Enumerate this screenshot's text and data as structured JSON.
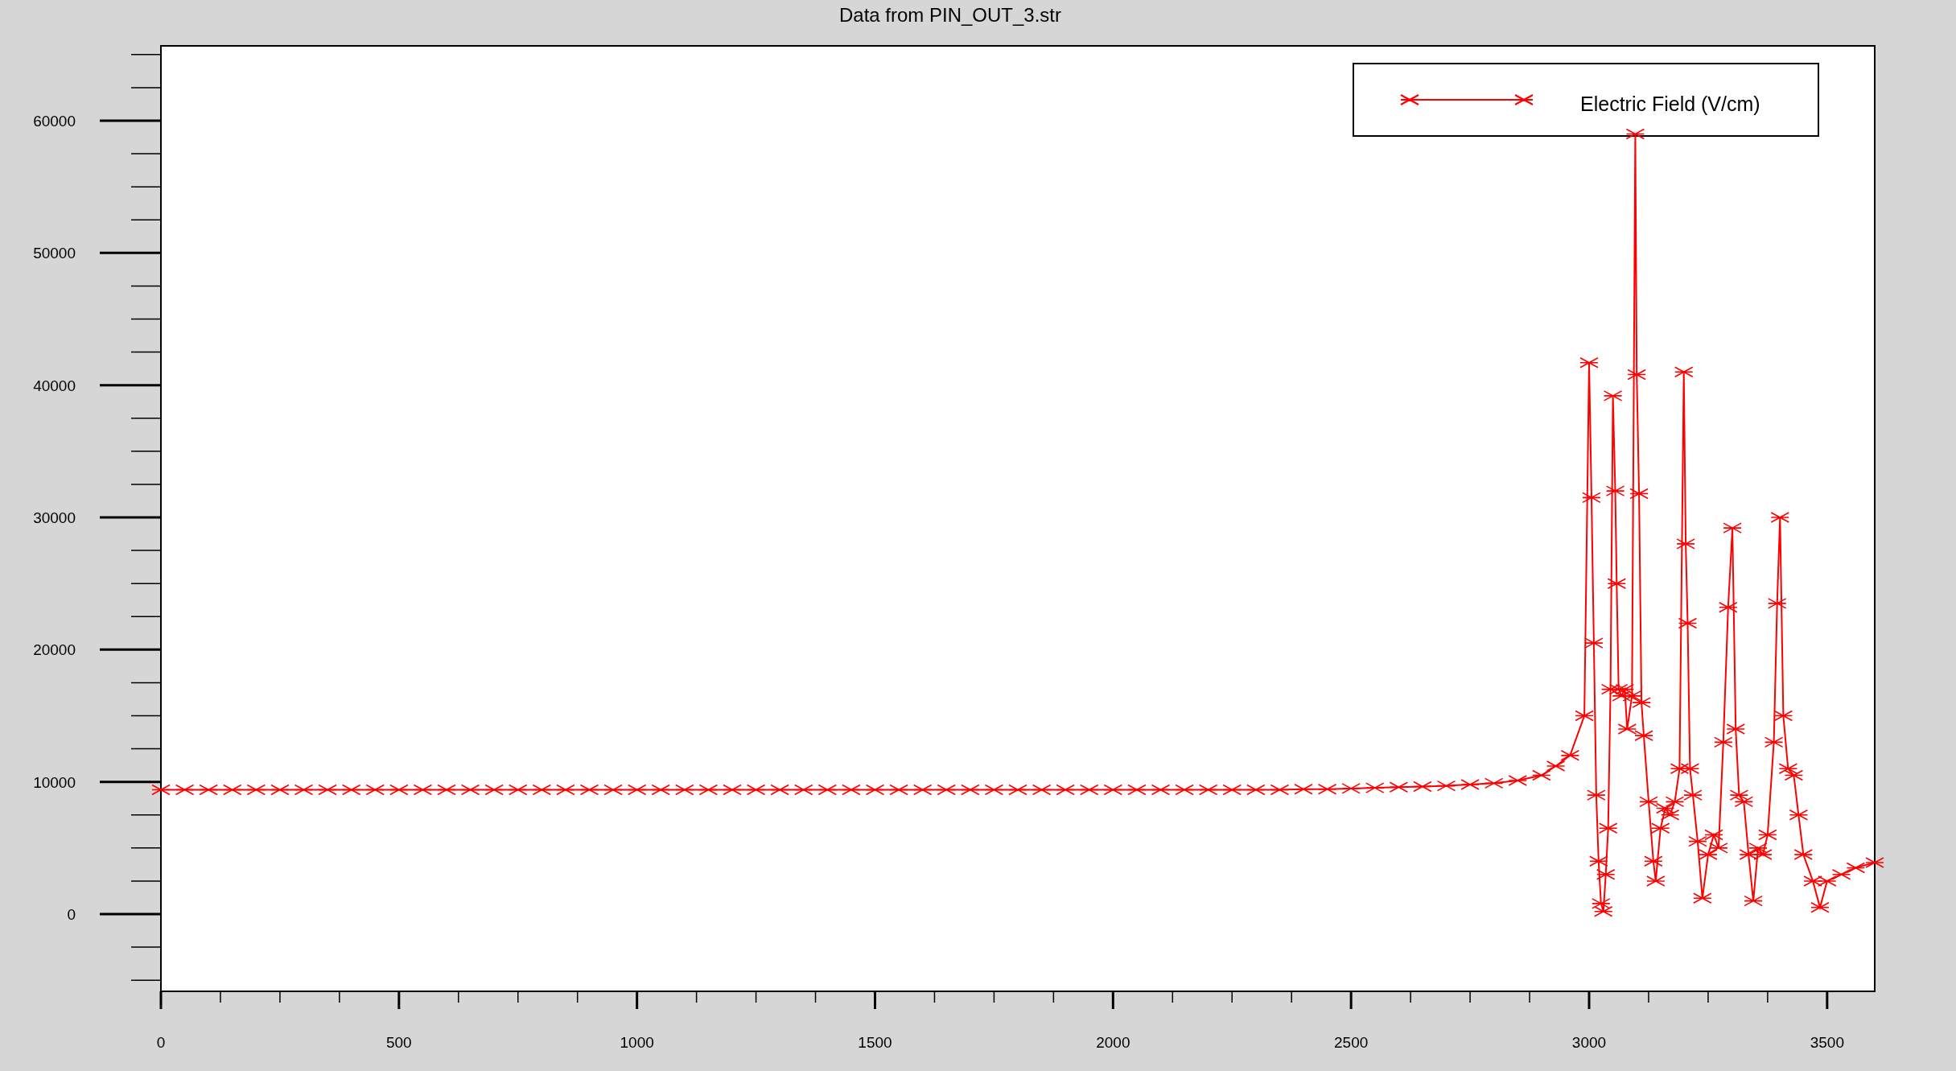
{
  "chart_data": {
    "type": "line",
    "title": "Data from PIN_OUT_3.str",
    "xlim": [
      0,
      3600
    ],
    "ylim": [
      -5840,
      65660
    ],
    "xticks": [
      0,
      500,
      1000,
      1500,
      2000,
      2500,
      3000,
      3500
    ],
    "yticks": [
      0,
      10000,
      20000,
      30000,
      40000,
      50000,
      60000
    ],
    "x": [
      0,
      50,
      100,
      150,
      200,
      250,
      300,
      350,
      400,
      450,
      500,
      550,
      600,
      650,
      700,
      750,
      800,
      850,
      900,
      950,
      1000,
      1050,
      1100,
      1150,
      1200,
      1250,
      1300,
      1350,
      1400,
      1450,
      1500,
      1550,
      1600,
      1650,
      1700,
      1750,
      1800,
      1850,
      1900,
      1950,
      2000,
      2050,
      2100,
      2150,
      2200,
      2250,
      2300,
      2350,
      2400,
      2450,
      2500,
      2550,
      2600,
      2650,
      2700,
      2750,
      2800,
      2850,
      2900,
      2930,
      2960,
      2990,
      3000,
      3005,
      3010,
      3015,
      3020,
      3025,
      3030,
      3035,
      3040,
      3045,
      3050,
      3055,
      3058,
      3062,
      3068,
      3075,
      3080,
      3090,
      3097,
      3100,
      3105,
      3110,
      3115,
      3125,
      3135,
      3140,
      3150,
      3160,
      3170,
      3180,
      3190,
      3199,
      3203,
      3207,
      3212,
      3218,
      3228,
      3238,
      3250,
      3262,
      3272,
      3282,
      3292,
      3301,
      3308,
      3315,
      3325,
      3335,
      3345,
      3355,
      3365,
      3375,
      3388,
      3395,
      3401,
      3408,
      3418,
      3430,
      3440,
      3450,
      3470,
      3485,
      3500,
      3530,
      3560,
      3600
    ],
    "series": [
      {
        "name": "Electric Field (V/cm)",
        "color": "#ff0000",
        "marker": "x",
        "values": [
          9400,
          9400,
          9400,
          9400,
          9400,
          9400,
          9400,
          9400,
          9400,
          9400,
          9400,
          9400,
          9400,
          9400,
          9400,
          9400,
          9400,
          9400,
          9400,
          9400,
          9400,
          9400,
          9400,
          9400,
          9400,
          9400,
          9400,
          9400,
          9400,
          9400,
          9400,
          9400,
          9400,
          9400,
          9400,
          9400,
          9400,
          9400,
          9400,
          9400,
          9400,
          9400,
          9400,
          9400,
          9400,
          9400,
          9400,
          9400,
          9450,
          9450,
          9500,
          9550,
          9600,
          9650,
          9700,
          9800,
          9900,
          10100,
          10500,
          11200,
          12000,
          15000,
          41700,
          31500,
          20500,
          9000,
          4000,
          800,
          200,
          3000,
          6500,
          17000,
          39200,
          32000,
          25000,
          17000,
          16500,
          17000,
          14000,
          16500,
          59000,
          40800,
          31800,
          16000,
          13500,
          8500,
          4000,
          2500,
          6500,
          8000,
          7500,
          8500,
          11000,
          41000,
          28000,
          22000,
          11000,
          9000,
          5500,
          1200,
          4500,
          6000,
          5000,
          13000,
          23200,
          29200,
          14000,
          9000,
          8500,
          4500,
          1000,
          5000,
          4500,
          6000,
          13000,
          23500,
          30000,
          15000,
          11000,
          10500,
          7500,
          4500,
          2500,
          500,
          2500,
          3000,
          3500,
          3900
        ]
      }
    ]
  }
}
